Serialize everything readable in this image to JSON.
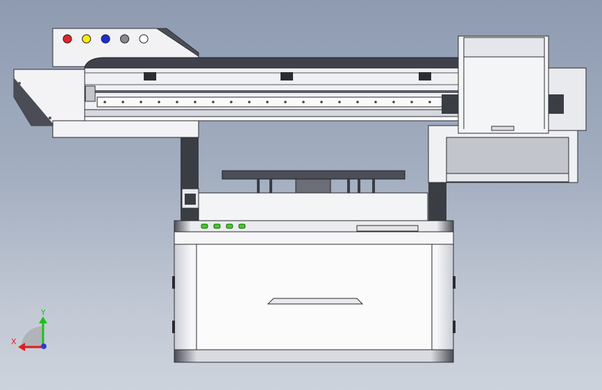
{
  "view": {
    "background_top": "#8e9bb1",
    "background_bottom": "#cdd3dc"
  },
  "ink_indicators": [
    {
      "name": "red-ink-indicator",
      "color": "#e0262a"
    },
    {
      "name": "yellow-ink-indicator",
      "color": "#f4ec12"
    },
    {
      "name": "blue-ink-indicator",
      "color": "#1b2fd6"
    },
    {
      "name": "gray-ink-indicator",
      "color": "#8a8a8a"
    },
    {
      "name": "white-ink-indicator",
      "color": "#ffffff"
    }
  ],
  "status_leds": [
    "#3cd11e",
    "#3cd11e",
    "#3cd11e",
    "#3cd11e"
  ],
  "triad": {
    "x_label": "X",
    "y_label": "Y",
    "x_color": "#e01e1e",
    "y_color": "#19c219",
    "z_color": "#2b3cd6"
  }
}
